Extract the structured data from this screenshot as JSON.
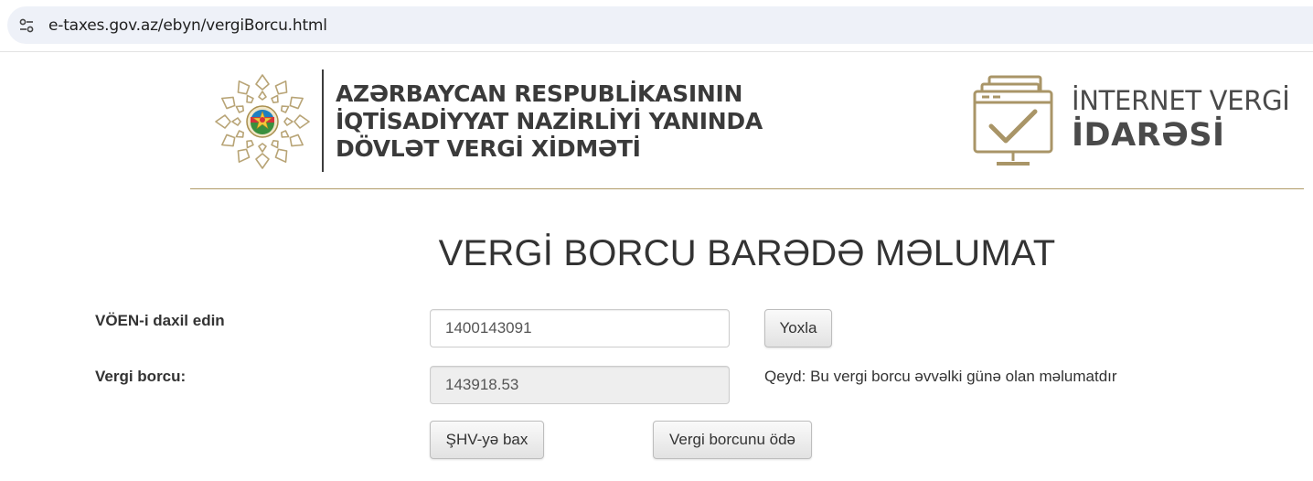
{
  "browser": {
    "url": "e-taxes.gov.az/ebyn/vergiBorcu.html",
    "site_info_icon": "tune-icon"
  },
  "header": {
    "emblem_icon": "azerbaijan-state-emblem-icon",
    "org_lines": [
      "AZƏRBAYCAN RESPUBLİKASININ",
      "İQTİSADİYYAT NAZİRLİYİ YANINDA",
      "DÖVLƏT VERGİ XİDMƏTİ"
    ],
    "portal_icon": "monitor-checkmark-icon",
    "portal_lines": [
      "İNTERNET VERGİ",
      "İDARƏSİ"
    ],
    "accent_color": "#b19b67"
  },
  "main": {
    "title": "VERGİ BORCU BARƏDƏ MƏLUMAT",
    "voen_label": "VÖEN-i daxil edin",
    "voen_value": "1400143091",
    "check_button": "Yoxla",
    "debt_label": "Vergi borcu:",
    "debt_value": "143918.53",
    "note": "Qeyd: Bu vergi borcu əvvəlki günə olan məlumatdır",
    "view_button": "ŞHV-yə bax",
    "pay_button": "Vergi borcunu ödə"
  }
}
